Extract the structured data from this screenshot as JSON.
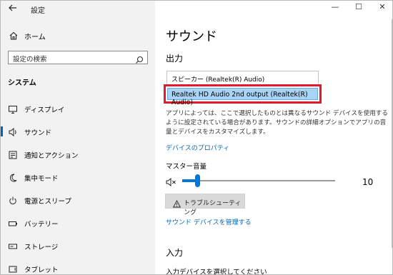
{
  "app": {
    "title": "設定",
    "back_icon": "back-arrow-icon"
  },
  "window_controls": {
    "minimize": "—",
    "maximize": "☐",
    "close": "✕"
  },
  "sidebar": {
    "home_label": "ホーム",
    "search_placeholder": "設定の検索",
    "section": "システム",
    "items": [
      {
        "label": "ディスプレイ",
        "icon": "display-icon",
        "active": false
      },
      {
        "label": "サウンド",
        "icon": "sound-icon",
        "active": true
      },
      {
        "label": "通知とアクション",
        "icon": "notifications-icon",
        "active": false
      },
      {
        "label": "集中モード",
        "icon": "focus-assist-icon",
        "active": false
      },
      {
        "label": "電源とスリープ",
        "icon": "power-icon",
        "active": false
      },
      {
        "label": "バッテリー",
        "icon": "battery-icon",
        "active": false
      },
      {
        "label": "ストレージ",
        "icon": "storage-icon",
        "active": false
      },
      {
        "label": "タブレット",
        "icon": "tablet-icon",
        "active": false
      }
    ]
  },
  "main": {
    "title": "サウンド",
    "output_heading": "出力",
    "output_options": [
      "スピーカー (Realtek(R) Audio)",
      "Realtek HD Audio 2nd output (Realtek(R) Audio)"
    ],
    "description": "アプリによっては、ここで選択したものとは異なるサウンド デバイスを使用するように設定されている場合があります。サウンドの詳細オプションでアプリの音量とデバイスをカスタマイズします。",
    "device_properties_link": "デバイスのプロパティ",
    "master_volume_label": "マスター音量",
    "master_volume_value": "10",
    "master_volume_percent": 10,
    "troubleshoot_label": "トラブルシューティング",
    "manage_devices_link": "サウンド デバイスを管理する",
    "input_heading": "入力",
    "input_sub": "入力デバイスを選択してください"
  },
  "colors": {
    "accent": "#0078d7",
    "highlight": "#a9d4f5",
    "callout": "#e4192c",
    "link": "#0066b4"
  }
}
